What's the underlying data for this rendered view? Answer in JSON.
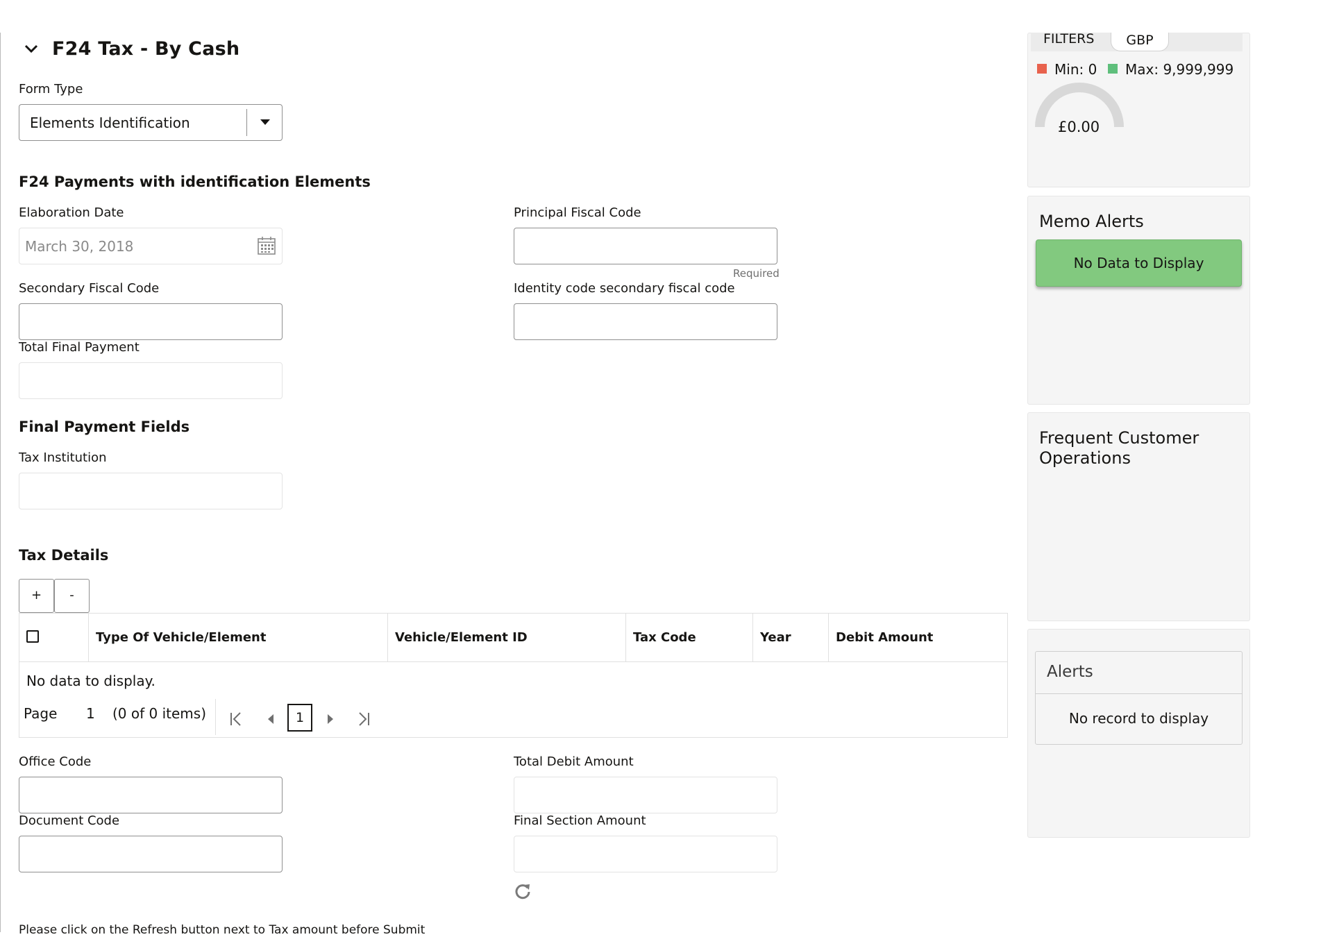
{
  "section": {
    "title": "F24 Tax - By Cash",
    "form_type_label": "Form Type",
    "form_type_value": "Elements Identification"
  },
  "identification": {
    "heading": "F24 Payments with identification Elements",
    "elaboration_date_label": "Elaboration Date",
    "elaboration_date_value": "March 30, 2018",
    "principal_fiscal_code_label": "Principal Fiscal Code",
    "principal_fiscal_code_value": "",
    "required_text": "Required",
    "secondary_fiscal_code_label": "Secondary Fiscal Code",
    "secondary_fiscal_code_value": "",
    "identity_code_label": "Identity code secondary fiscal code",
    "identity_code_value": "",
    "total_final_payment_label": "Total Final Payment",
    "total_final_payment_value": ""
  },
  "final_payment": {
    "heading": "Final Payment Fields",
    "tax_institution_label": "Tax Institution",
    "tax_institution_value": ""
  },
  "tax_details": {
    "heading": "Tax Details",
    "add_label": "+",
    "remove_label": "-",
    "columns": [
      "Type Of Vehicle/Element",
      "Vehicle/Element ID",
      "Tax Code",
      "Year",
      "Debit Amount"
    ],
    "empty_text": "No data to display.",
    "pager": {
      "page_label": "Page",
      "page_number": "1",
      "items_text": "(0 of 0 items)",
      "current_page": "1"
    }
  },
  "bottom": {
    "office_code_label": "Office Code",
    "office_code_value": "",
    "total_debit_amount_label": "Total Debit Amount",
    "total_debit_amount_value": "",
    "document_code_label": "Document Code",
    "document_code_value": "",
    "final_section_amount_label": "Final Section Amount",
    "final_section_amount_value": "",
    "note": "Please click on the Refresh button next to Tax amount before Submit"
  },
  "right_panel": {
    "limits": {
      "filters_label": "FILTERS",
      "currency": "GBP",
      "min_label": "Min: 0",
      "max_label": "Max: 9,999,999",
      "gauge_value": "£0.00",
      "gauge_fraction": 0,
      "min_color": "#e8624d",
      "max_color": "#5fbf7c"
    },
    "memo_alerts": {
      "title": "Memo Alerts",
      "button_text": "No Data to Display",
      "button_color": "#82c97f"
    },
    "frequent_ops": {
      "title_line1": "Frequent Customer",
      "title_line2": "Operations"
    },
    "alerts": {
      "title": "Alerts",
      "empty_text": "No record to display"
    }
  },
  "icons": {
    "collapse": "chevron-down-icon",
    "calendar": "calendar-icon",
    "dropdown": "caret-down-icon",
    "refresh": "refresh-icon",
    "first_page": "first-page-icon",
    "prev_page": "prev-page-icon",
    "next_page": "next-page-icon",
    "last_page": "last-page-icon"
  }
}
